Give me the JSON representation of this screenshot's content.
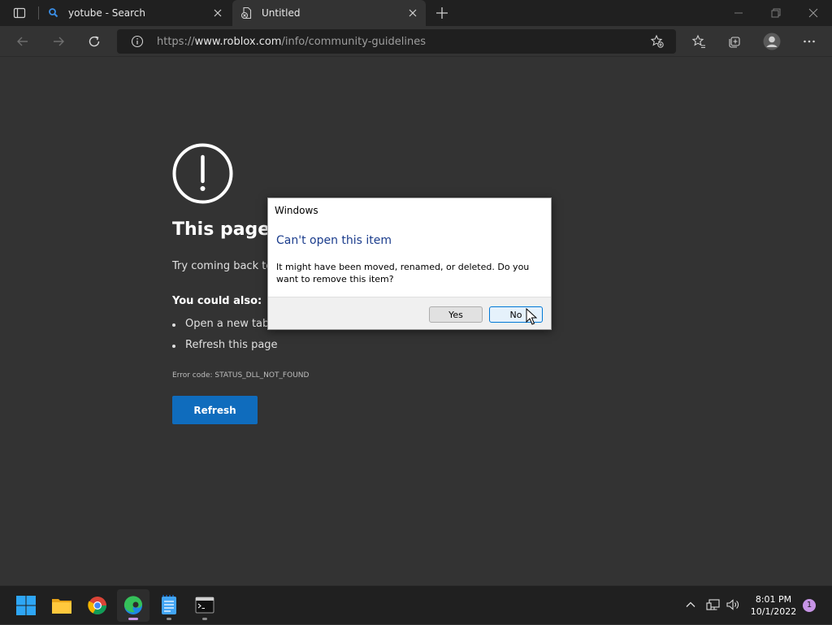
{
  "browser": {
    "tabs": [
      {
        "title": "yotube - Search",
        "active": false
      },
      {
        "title": "Untitled",
        "active": true
      }
    ],
    "address": {
      "url_prefix": "https://",
      "url_domain": "www.roblox.com",
      "url_path": "/info/community-guidelines"
    }
  },
  "error_page": {
    "title": "This page i",
    "try_text": "Try coming back to",
    "could_also": "You could also:",
    "suggestions": [
      "Open a new tab",
      "Refresh this page"
    ],
    "error_code": "Error code: STATUS_DLL_NOT_FOUND",
    "refresh_label": "Refresh"
  },
  "dialog": {
    "caption": "Windows",
    "heading": "Can't open this item",
    "body": "It might have been moved, renamed, or deleted. Do you want to remove this item?",
    "yes_label": "Yes",
    "no_label": "No"
  },
  "taskbar": {
    "time": "8:01 PM",
    "date": "10/1/2022",
    "notification_count": "1"
  },
  "colors": {
    "accent": "#0f6cbd",
    "background": "#333333",
    "chrome": "#202020",
    "dialog_heading": "#1a3c8c"
  }
}
